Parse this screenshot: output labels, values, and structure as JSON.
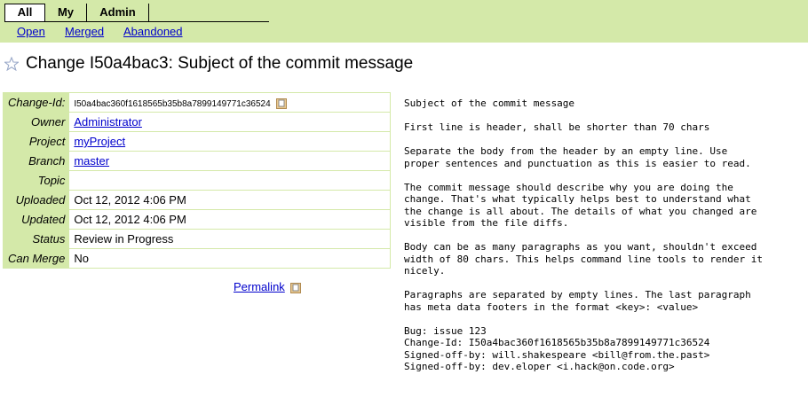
{
  "nav": {
    "tabs": [
      {
        "label": "All",
        "active": true
      },
      {
        "label": "My",
        "active": false
      },
      {
        "label": "Admin",
        "active": false
      }
    ],
    "sublinks": [
      "Open",
      "Merged",
      "Abandoned"
    ]
  },
  "title": "Change I50a4bac3: Subject of the commit message",
  "info": {
    "rows": [
      {
        "label": "Change-Id:",
        "value": "I50a4bac360f1618565b35b8a7899149771c36524"
      },
      {
        "label": "Owner",
        "value": "Administrator"
      },
      {
        "label": "Project",
        "value": "myProject"
      },
      {
        "label": "Branch",
        "value": "master"
      },
      {
        "label": "Topic",
        "value": ""
      },
      {
        "label": "Uploaded",
        "value": "Oct 12, 2012 4:06 PM"
      },
      {
        "label": "Updated",
        "value": "Oct 12, 2012 4:06 PM"
      },
      {
        "label": "Status",
        "value": "Review in Progress"
      },
      {
        "label": "Can Merge",
        "value": "No"
      }
    ]
  },
  "permalink": "Permalink",
  "commit_message": [
    "Subject of the commit message",
    "",
    "First line is header, shall be shorter than 70 chars",
    "",
    "Separate the body from the header by an empty line. Use",
    "proper sentences and punctuation as this is easier to read.",
    "",
    "The commit message should describe why you are doing the",
    "change. That's what typically helps best to understand what",
    "the change is all about. The details of what you changed are",
    "visible from the file diffs.",
    "",
    "Body can be as many paragraphs as you want, shouldn't exceed",
    "width of 80 chars. This helps command line tools to render it",
    "nicely.",
    "",
    "Paragraphs are separated by empty lines. The last paragraph",
    "has meta data footers in the format <key>: <value>",
    "",
    "Bug: issue 123",
    "Change-Id: I50a4bac360f1618565b35b8a7899149771c36524",
    "Signed-off-by: will.shakespeare <bill@from.the.past>",
    "Signed-off-by: dev.eloper <i.hack@on.code.org>"
  ],
  "colors": {
    "header_bg": "#d4e9a9",
    "link": "#0000cc"
  },
  "icons": {
    "star": "star-icon",
    "copy": "copy-icon"
  }
}
